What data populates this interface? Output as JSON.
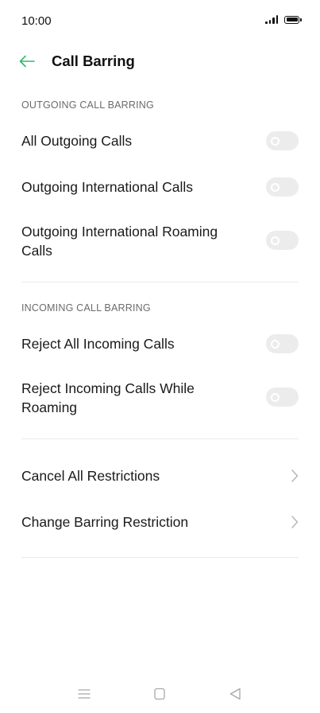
{
  "status_bar": {
    "time": "10:00",
    "signal_icon": "signal-bars-icon",
    "battery_icon": "battery-full-icon"
  },
  "header": {
    "back_icon": "arrow-left-icon",
    "title": "Call Barring"
  },
  "colors": {
    "accent": "#2dbb6e",
    "toggle_off": "#ececec",
    "section_text": "#6b6b6b",
    "divider": "#ebebeb"
  },
  "outgoing": {
    "title": "OUTGOING CALL BARRING",
    "items": [
      {
        "label": "All Outgoing Calls",
        "enabled": false
      },
      {
        "label": "Outgoing International Calls",
        "enabled": false
      },
      {
        "label": "Outgoing International Roaming Calls",
        "enabled": false
      }
    ]
  },
  "incoming": {
    "title": "INCOMING CALL BARRING",
    "items": [
      {
        "label": "Reject All Incoming Calls",
        "enabled": false
      },
      {
        "label": "Reject Incoming Calls While Roaming",
        "enabled": false
      }
    ]
  },
  "actions": {
    "items": [
      {
        "label": "Cancel All Restrictions",
        "icon": "chevron-right-icon"
      },
      {
        "label": "Change Barring Restriction",
        "icon": "chevron-right-icon"
      }
    ]
  },
  "nav_bar": {
    "menu_icon": "menu-icon",
    "home_icon": "home-square-icon",
    "back_icon": "back-triangle-icon"
  }
}
